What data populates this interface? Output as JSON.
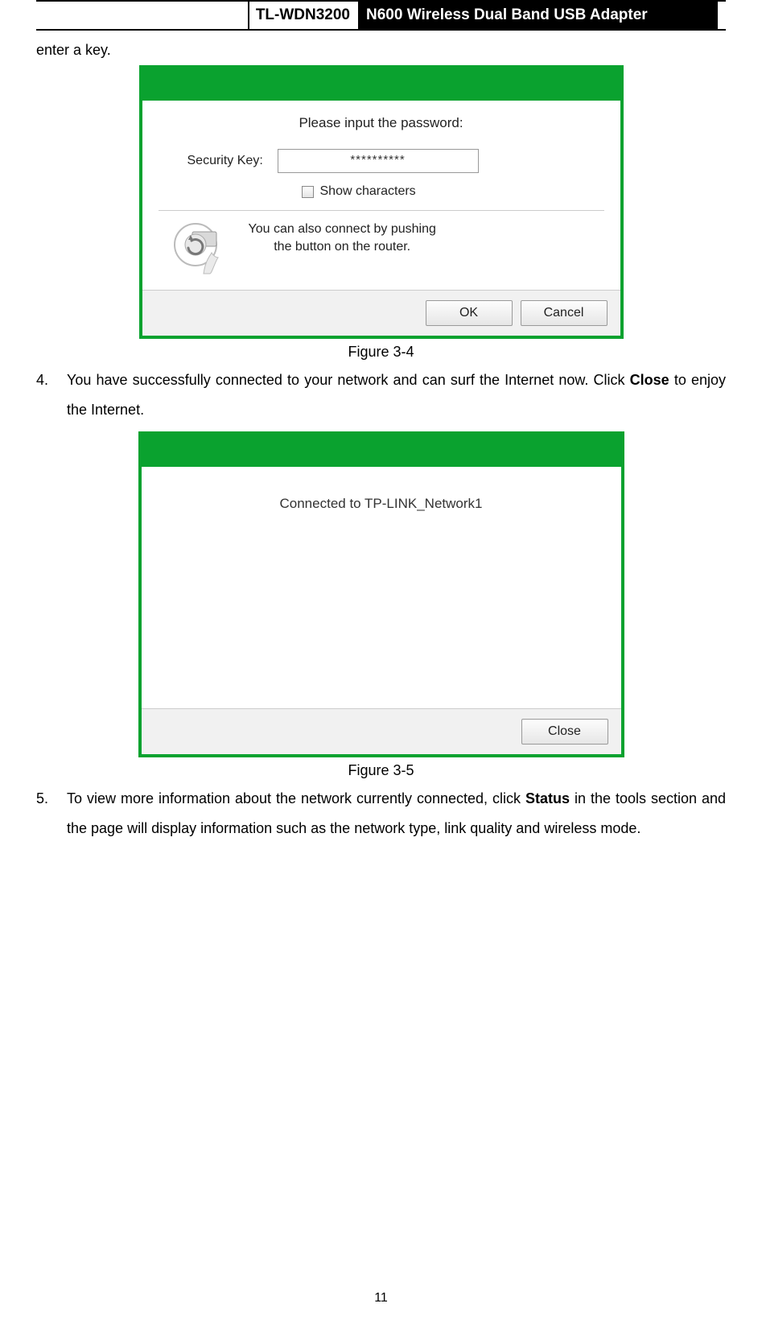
{
  "header": {
    "model": "TL-WDN3200",
    "product": "N600 Wireless Dual Band USB Adapter"
  },
  "intro_line": "enter a key.",
  "dialog1": {
    "prompt": "Please input the password:",
    "key_label": "Security Key:",
    "key_value": "**********",
    "show_chars": "Show characters",
    "push_line1": "You can also connect by pushing",
    "push_line2": "the button on the router.",
    "ok": "OK",
    "cancel": "Cancel"
  },
  "caption1": "Figure 3-4",
  "step4": {
    "num": "4.",
    "text_a": "You have successfully connected to your network and can surf the Internet now. Click ",
    "bold": "Close",
    "text_b": " to enjoy the Internet."
  },
  "dialog2": {
    "status": "Connected to TP-LINK_Network1",
    "close": "Close"
  },
  "caption2": "Figure 3-5",
  "step5": {
    "num": "5.",
    "text_a": "To view more information about the network currently connected, click ",
    "bold": "Status",
    "text_b": " in the tools section and the page will display information such as the network type, link quality and wireless mode."
  },
  "page_number": "11"
}
